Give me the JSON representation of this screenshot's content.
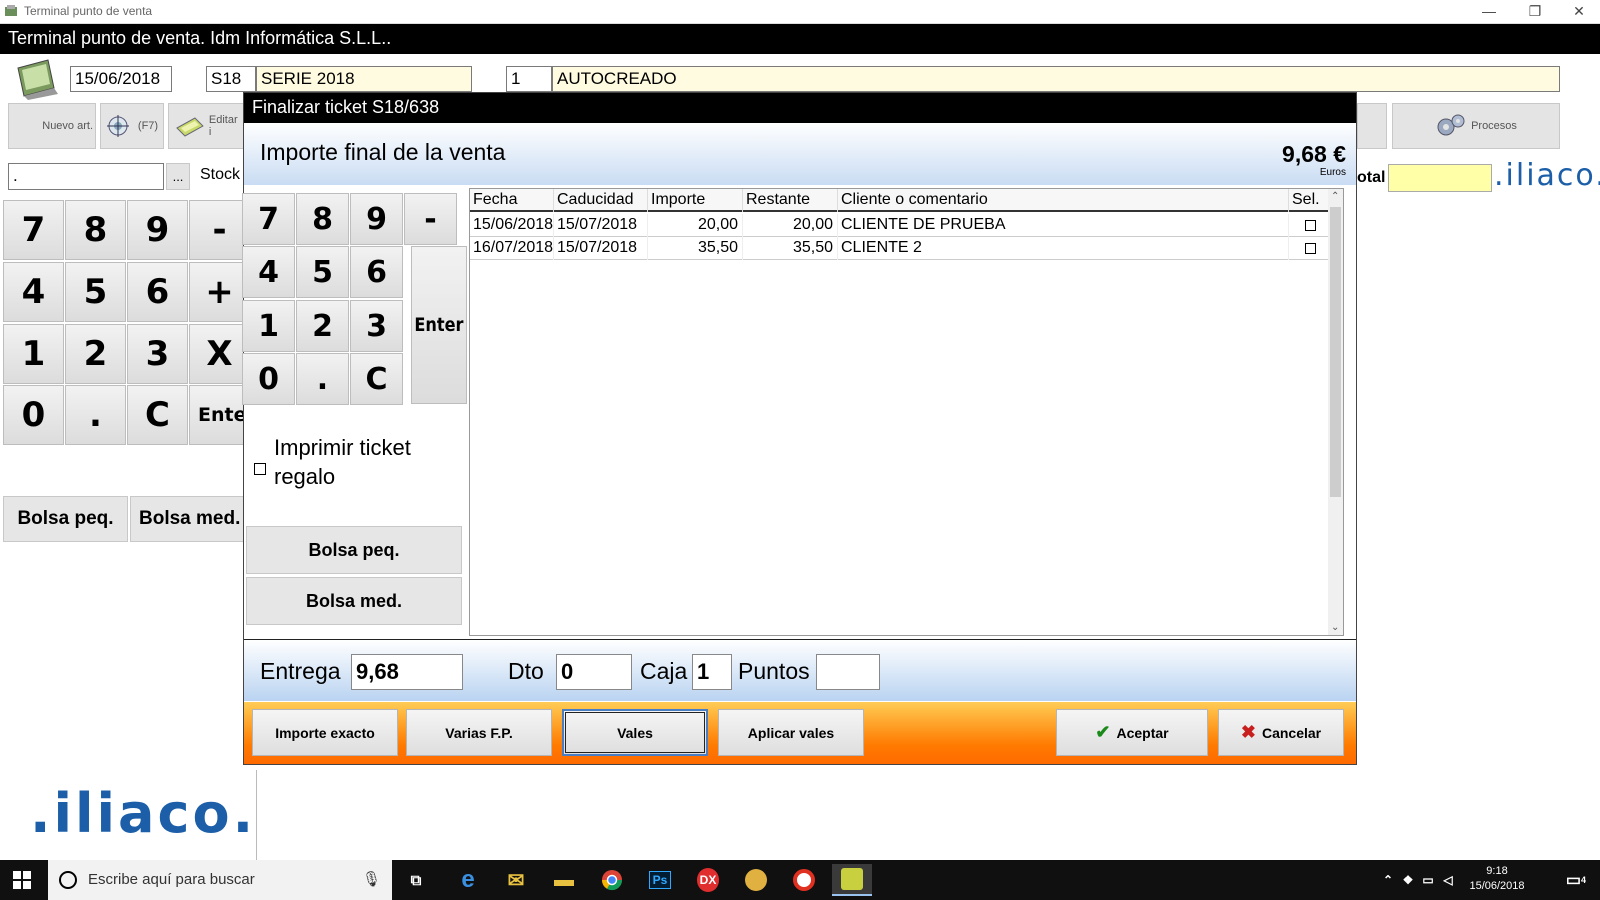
{
  "window": {
    "title": "Terminal punto de venta",
    "app_title": "Terminal punto de venta. Idm Informática S.L.L.."
  },
  "header": {
    "date": "15/06/2018",
    "serie_code": "S18",
    "serie_name": "SERIE 2018",
    "client_code": "1",
    "client_name": "AUTOCREADO"
  },
  "toolbar": {
    "nuevo_art": "Nuevo art.",
    "f7": "(F7)",
    "editar": "Editar i",
    "procesos": "Procesos"
  },
  "main": {
    "search_value": ".",
    "search_btn": "...",
    "stock_label": "Stock",
    "total_label": "otal",
    "brand": ".iliaco.",
    "keypad": [
      "7",
      "8",
      "9",
      "-",
      "4",
      "5",
      "6",
      "+",
      "1",
      "2",
      "3",
      "X",
      "0",
      ".",
      "C",
      "Enter"
    ],
    "bolsa_peq": "Bolsa peq.",
    "bolsa_med": "Bolsa med."
  },
  "dialog": {
    "title": "Finalizar ticket S18/638",
    "header_label": "Importe final de la venta",
    "amount": "9,68 €",
    "currency": "Euros",
    "keypad": [
      "7",
      "8",
      "9",
      "-",
      "4",
      "5",
      "6",
      "1",
      "2",
      "3",
      "0",
      ".",
      "C"
    ],
    "enter": "Enter",
    "gift_checkbox": "Imprimir ticket regalo",
    "bolsa_peq": "Bolsa peq.",
    "bolsa_med": "Bolsa med.",
    "grid": {
      "columns": [
        "Fecha",
        "Caducidad",
        "Importe",
        "Restante",
        "Cliente o comentario",
        "Sel."
      ],
      "rows": [
        {
          "fecha": "15/06/2018",
          "caducidad": "15/07/2018",
          "importe": "20,00",
          "restante": "20,00",
          "cliente": "CLIENTE DE PRUEBA",
          "sel": false
        },
        {
          "fecha": "16/07/2018",
          "caducidad": "15/07/2018",
          "importe": "35,50",
          "restante": "35,50",
          "cliente": "CLIENTE 2",
          "sel": false
        }
      ]
    },
    "entrega_label": "Entrega",
    "entrega_value": "9,68",
    "dto_label": "Dto",
    "dto_value": "0",
    "caja_label": "Caja",
    "caja_value": "1",
    "puntos_label": "Puntos",
    "puntos_value": "",
    "buttons": {
      "importe_exacto": "Importe exacto",
      "varias_fp": "Varias F.P.",
      "vales": "Vales",
      "aplicar_vales": "Aplicar vales",
      "aceptar": "Aceptar",
      "cancelar": "Cancelar"
    }
  },
  "taskbar": {
    "search_placeholder": "Escribe aquí para buscar",
    "time": "9:18",
    "date": "15/06/2018",
    "notif_count": "4"
  },
  "colors": {
    "dialog_orange": "#ff7a00",
    "header_blue": "#c9dcf3",
    "brand_blue": "#1c5fa8"
  }
}
